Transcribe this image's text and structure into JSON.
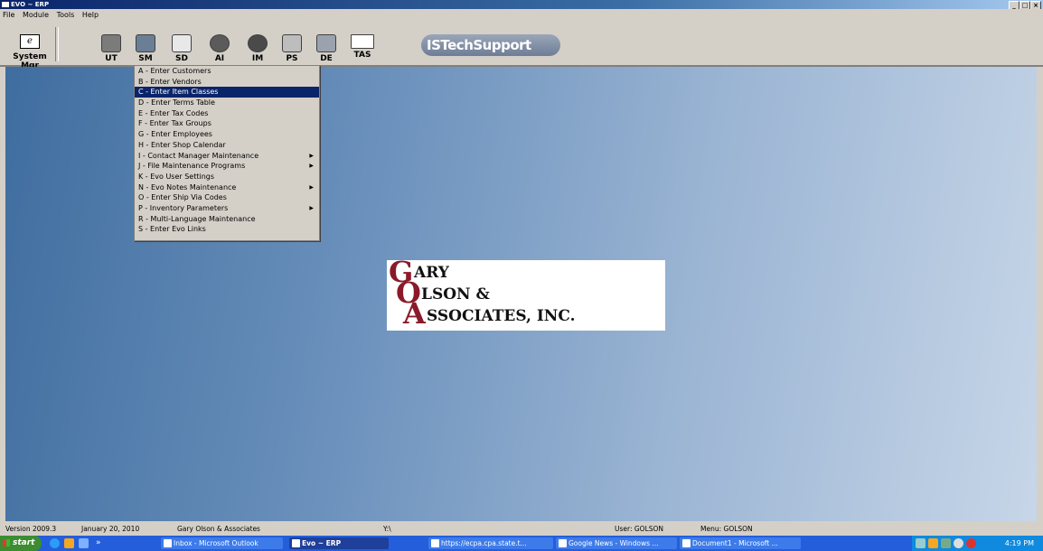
{
  "window": {
    "title": "EVO ~ ERP",
    "controls": [
      "_",
      "□",
      "×"
    ]
  },
  "menubar": [
    "File",
    "Module",
    "Tools",
    "Help"
  ],
  "toolbar": {
    "system_mgr": {
      "glyph": "e",
      "label": "System Mgr"
    },
    "buttons": [
      {
        "label": "UT",
        "icon": "printer-icon"
      },
      {
        "label": "SM",
        "icon": "computer-icon"
      },
      {
        "label": "SD",
        "icon": "gears-icon"
      },
      {
        "label": "AI",
        "icon": "disc-icon"
      },
      {
        "label": "IM",
        "icon": "globe-icon"
      },
      {
        "label": "PS",
        "icon": "register-icon"
      },
      {
        "label": "DE",
        "icon": "network-icon"
      },
      {
        "label": "TAS",
        "icon": "tas-icon"
      }
    ],
    "brand": "ISTechSupport"
  },
  "dropdown": {
    "items": [
      {
        "label": "A - Enter Customers",
        "submenu": false,
        "selected": false
      },
      {
        "label": "B - Enter Vendors",
        "submenu": false,
        "selected": false
      },
      {
        "label": "C - Enter Item Classes",
        "submenu": false,
        "selected": true
      },
      {
        "label": "D - Enter Terms Table",
        "submenu": false,
        "selected": false
      },
      {
        "label": "E - Enter Tax Codes",
        "submenu": false,
        "selected": false
      },
      {
        "label": "F - Enter Tax Groups",
        "submenu": false,
        "selected": false
      },
      {
        "label": "G - Enter Employees",
        "submenu": false,
        "selected": false
      },
      {
        "label": "H - Enter Shop Calendar",
        "submenu": false,
        "selected": false
      },
      {
        "label": "I - Contact Manager Maintenance",
        "submenu": true,
        "selected": false
      },
      {
        "label": "J - File Maintenance Programs",
        "submenu": true,
        "selected": false
      },
      {
        "label": "K - Evo User Settings",
        "submenu": false,
        "selected": false
      },
      {
        "label": "N - Evo Notes Maintenance",
        "submenu": true,
        "selected": false
      },
      {
        "label": "O - Enter Ship Via Codes",
        "submenu": false,
        "selected": false
      },
      {
        "label": "P - Inventory Parameters",
        "submenu": true,
        "selected": false
      },
      {
        "label": "R - Multi-Language Maintenance",
        "submenu": false,
        "selected": false
      },
      {
        "label": "S - Enter Evo Links",
        "submenu": false,
        "selected": false
      }
    ]
  },
  "logo": {
    "line1": "ARY",
    "line2": "LSON &",
    "line3": "SSOCIATES, INC.",
    "initials": [
      "G",
      "O",
      "A"
    ]
  },
  "statusbar": {
    "version": "Version 2009.3",
    "date": "January 20, 2010",
    "company": "Gary Olson & Associates",
    "path": "Y:\\",
    "user": "User: GOLSON",
    "menu": "Menu: GOLSON"
  },
  "taskbar": {
    "start": "start",
    "more": "»",
    "tasks": [
      {
        "label": "Inbox - Microsoft Outlook",
        "active": false
      },
      {
        "label": "Evo ~ ERP",
        "active": true
      },
      {
        "label": "https://ecpa.cpa.state.t...",
        "active": false
      },
      {
        "label": "Google News - Windows ...",
        "active": false
      },
      {
        "label": "Document1 - Microsoft ...",
        "active": false
      }
    ],
    "clock": "4:19 PM"
  },
  "colors": {
    "menu_highlight": "#0a246a",
    "logo_red": "#8a1a2a",
    "taskbar": "#245edb"
  }
}
